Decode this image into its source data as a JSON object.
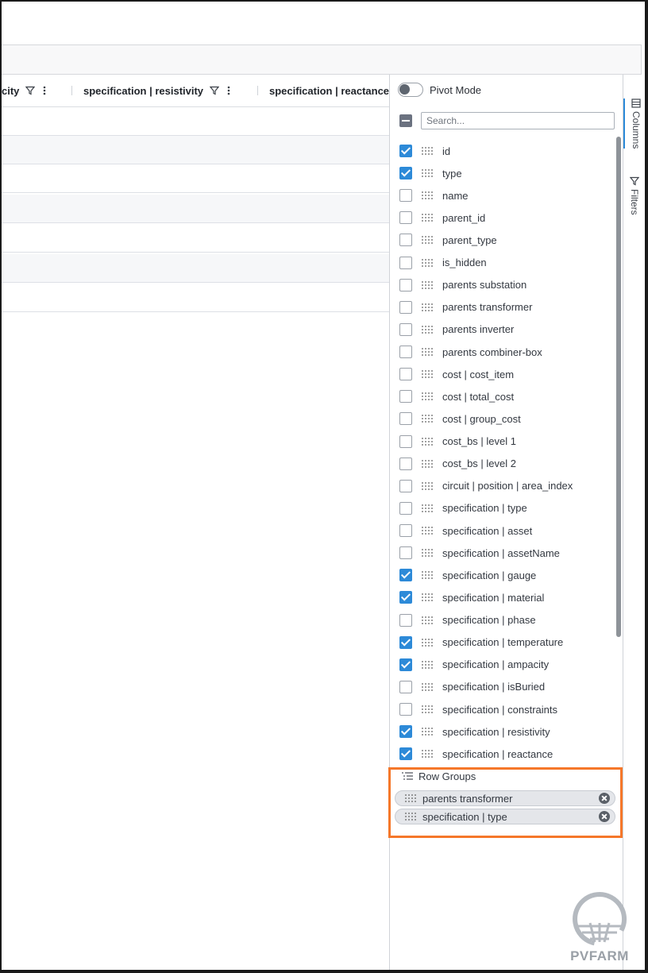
{
  "grid": {
    "headers": [
      {
        "label": "city"
      },
      {
        "label": "specification | resistivity"
      },
      {
        "label": "specification | reactance"
      }
    ]
  },
  "panel": {
    "pivot_label": "Pivot Mode",
    "search_placeholder": "Search...",
    "columns": [
      {
        "label": "id",
        "checked": true
      },
      {
        "label": "type",
        "checked": true
      },
      {
        "label": "name",
        "checked": false
      },
      {
        "label": "parent_id",
        "checked": false
      },
      {
        "label": "parent_type",
        "checked": false
      },
      {
        "label": "is_hidden",
        "checked": false
      },
      {
        "label": "parents substation",
        "checked": false
      },
      {
        "label": "parents transformer",
        "checked": false
      },
      {
        "label": "parents inverter",
        "checked": false
      },
      {
        "label": "parents combiner-box",
        "checked": false
      },
      {
        "label": "cost | cost_item",
        "checked": false
      },
      {
        "label": "cost | total_cost",
        "checked": false
      },
      {
        "label": "cost | group_cost",
        "checked": false
      },
      {
        "label": "cost_bs | level 1",
        "checked": false
      },
      {
        "label": "cost_bs | level 2",
        "checked": false
      },
      {
        "label": "circuit | position | area_index",
        "checked": false
      },
      {
        "label": "specification | type",
        "checked": false
      },
      {
        "label": "specification | asset",
        "checked": false
      },
      {
        "label": "specification | assetName",
        "checked": false
      },
      {
        "label": "specification | gauge",
        "checked": true
      },
      {
        "label": "specification | material",
        "checked": true
      },
      {
        "label": "specification | phase",
        "checked": false
      },
      {
        "label": "specification | temperature",
        "checked": true
      },
      {
        "label": "specification | ampacity",
        "checked": true
      },
      {
        "label": "specification | isBuried",
        "checked": false
      },
      {
        "label": "specification | constraints",
        "checked": false
      },
      {
        "label": "specification | resistivity",
        "checked": true
      },
      {
        "label": "specification | reactance",
        "checked": true
      }
    ],
    "row_groups": {
      "title": "Row Groups",
      "items": [
        {
          "label": "parents transformer"
        },
        {
          "label": "specification | type"
        }
      ]
    }
  },
  "sidebar": {
    "tabs": [
      {
        "label": "Columns",
        "icon": "columns-icon"
      },
      {
        "label": "Filters",
        "icon": "filter-icon"
      }
    ]
  },
  "logo": {
    "text": "PVFARM"
  },
  "colors": {
    "accent": "#2d8ad8",
    "highlight": "#f5772a"
  }
}
